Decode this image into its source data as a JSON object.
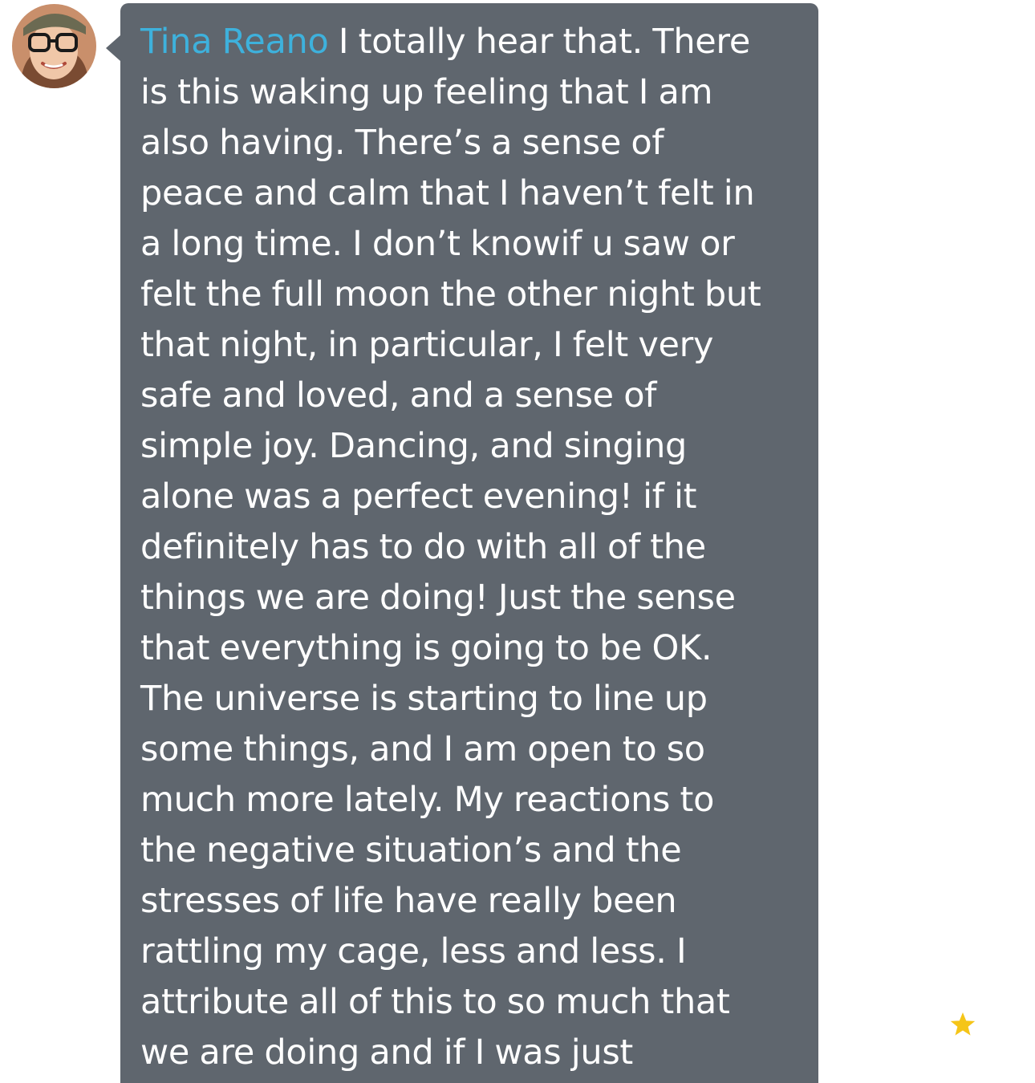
{
  "comment": {
    "author": "Tina Reano",
    "lines": [
      "I totally hear that. There",
      "is this waking up feeling that I am",
      "also having. There’s a sense of",
      "peace and calm that I haven’t felt in",
      "a long time. I don’t knowif u saw or",
      "felt the full moon the other night but",
      "that night, in particular, I felt very",
      "safe and loved, and a sense of",
      "simple joy. Dancing, and singing",
      "alone was a perfect evening! if it",
      "definitely has to do with all of the",
      "things we are doing! Just the sense",
      "that everything is going to be OK.",
      "The universe is starting to line up",
      "some things, and I am open to so",
      "much more lately. My reactions to",
      "the negative situation’s and the",
      "stresses of life have really been",
      "rattling my cage, less and less. I",
      "attribute all of this to so much that",
      "we are doing and if I was just"
    ]
  },
  "icons": {
    "avatar": "user-avatar-photo",
    "star": "star-icon"
  },
  "colors": {
    "bubble_background": "#5f666e",
    "author_name": "#3eb1dc",
    "message_text": "#ffffff",
    "star": "#f5c518"
  }
}
